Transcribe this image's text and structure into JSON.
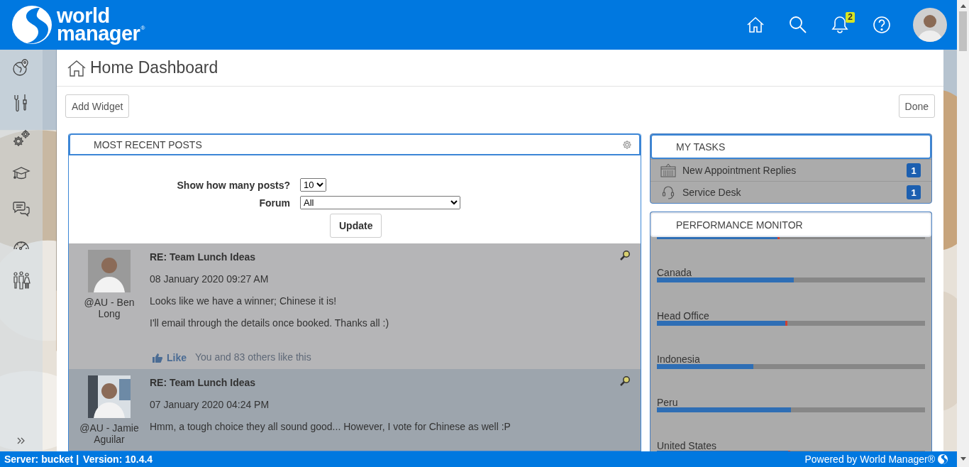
{
  "header": {
    "logo": {
      "line_1": "world",
      "line_2": "manager",
      "mark": "®"
    },
    "notification_count": "2"
  },
  "sidebar": {
    "items": [
      {
        "kind": "globe"
      },
      {
        "kind": "tools"
      },
      {
        "kind": "gears"
      },
      {
        "kind": "cap"
      },
      {
        "kind": "chat"
      },
      {
        "kind": "gauge"
      },
      {
        "kind": "people"
      }
    ]
  },
  "page": {
    "title": "Home Dashboard",
    "add_button": "Add Widget",
    "done_button": "Done"
  },
  "posts_widget": {
    "title": "MOST RECENT POSTS",
    "count_label": "Show how many posts?",
    "count_value": "10",
    "forum_label": "Forum",
    "forum_value": "All",
    "update_button": "Update",
    "posts": [
      {
        "title": "RE: Team Lunch Ideas",
        "date": "08 January 2020 09:27 AM",
        "author": "@AU - Ben Long",
        "highlighted": false,
        "paragraphs": [
          "Looks like we have a winner; Chinese it is!",
          "I'll email through the details once booked. Thanks all :)"
        ],
        "like_label": "Like",
        "like_text": "You and 83 others like this"
      },
      {
        "title": "RE: Team Lunch Ideas",
        "date": "07 January 2020 04:24 PM",
        "author": "@AU - Jamie Aguilar",
        "highlighted": true,
        "paragraphs": [
          "Hmm, a tough choice they all sound good... However, I vote for Chinese as well :P"
        ]
      }
    ]
  },
  "tasks_widget": {
    "title": "MY TASKS",
    "items": [
      {
        "kind": "calendar",
        "label": "New Appointment Replies",
        "count": "1"
      },
      {
        "kind": "headset",
        "label": "Service Desk",
        "count": "1"
      }
    ]
  },
  "performance_widget": {
    "title": "PERFORMANCE MONITOR",
    "items": [
      {
        "level": 0.45,
        "target_mark": true
      },
      {
        "label": "Canada",
        "level": 0.51,
        "target_mark": false
      },
      {
        "label": "Head Office",
        "level": 0.48,
        "target_mark": true
      },
      {
        "label": "Indonesia",
        "level": 0.36,
        "target_mark": false
      },
      {
        "label": "Peru",
        "level": 0.5,
        "target_mark": false
      },
      {
        "label": "United States",
        "level": 0.49,
        "target_mark": true
      }
    ]
  },
  "status_bar": {
    "server": "Server: bucket |",
    "version": "Version: 10.4.4",
    "powered_by": "Powered by World Manager®"
  }
}
